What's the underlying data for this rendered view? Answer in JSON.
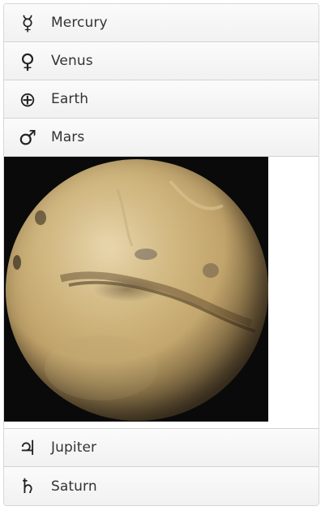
{
  "accordion": {
    "items": [
      {
        "label": "Mercury",
        "symbol": "☿",
        "icon": "mercury-symbol-icon"
      },
      {
        "label": "Venus",
        "symbol": "♀",
        "icon": "venus-symbol-icon"
      },
      {
        "label": "Earth",
        "symbol": "⊕",
        "icon": "earth-symbol-icon"
      },
      {
        "label": "Mars",
        "symbol": "♂",
        "icon": "mars-symbol-icon",
        "expanded": true
      },
      {
        "label": "Jupiter",
        "symbol": "♃",
        "icon": "jupiter-symbol-icon"
      },
      {
        "label": "Saturn",
        "symbol": "♄",
        "icon": "saturn-symbol-icon"
      }
    ],
    "panel_image": "mars-globe-image"
  },
  "colors": {
    "header_background": "#f4f4f4",
    "border": "#d3d3d3",
    "label_text": "#333333"
  }
}
